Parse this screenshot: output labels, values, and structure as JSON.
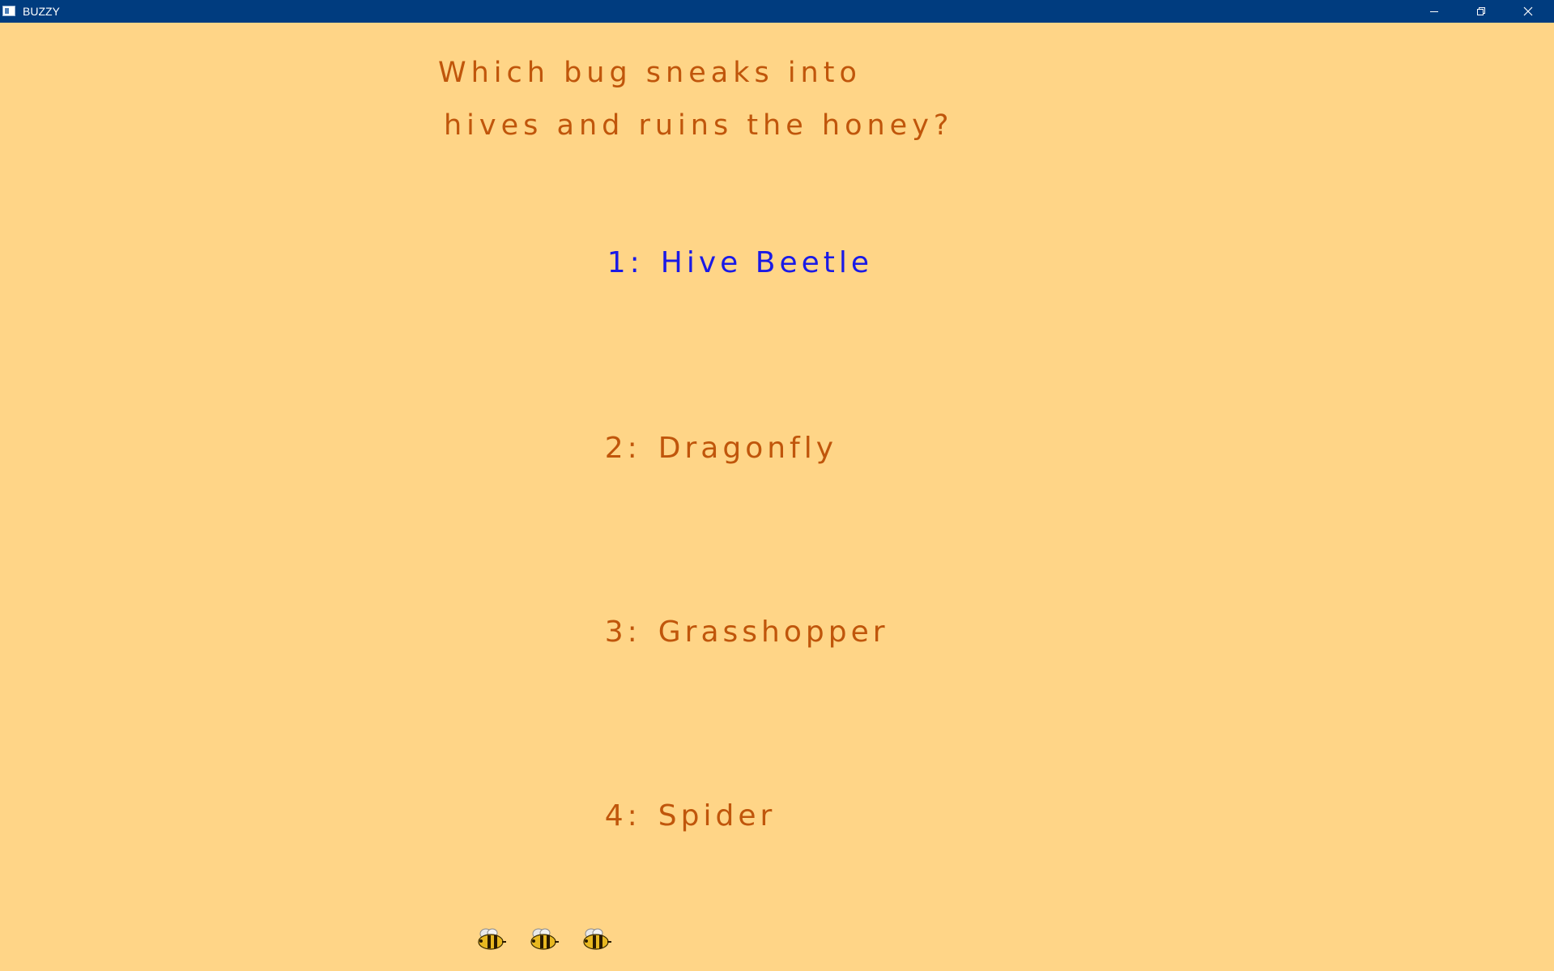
{
  "window": {
    "title": "BUZZY",
    "controls": {
      "minimize_icon": "minimize-icon",
      "restore_icon": "restore-icon",
      "close_icon": "close-icon"
    }
  },
  "question": {
    "line1": "Which bug sneaks into",
    "line2": "hives and ruins the honey?"
  },
  "answers": [
    {
      "number": "1:",
      "label": "Hive Beetle",
      "selected": true
    },
    {
      "number": "2:",
      "label": "Dragonfly",
      "selected": false
    },
    {
      "number": "3:",
      "label": "Grasshopper",
      "selected": false
    },
    {
      "number": "4:",
      "label": "Spider",
      "selected": false
    }
  ],
  "lives": {
    "count": 3,
    "icon": "bee-icon"
  },
  "colors": {
    "background": "#FFD587",
    "titlebar": "#003C7F",
    "text": "#C0560B",
    "selected_text": "#1A1AE6"
  }
}
